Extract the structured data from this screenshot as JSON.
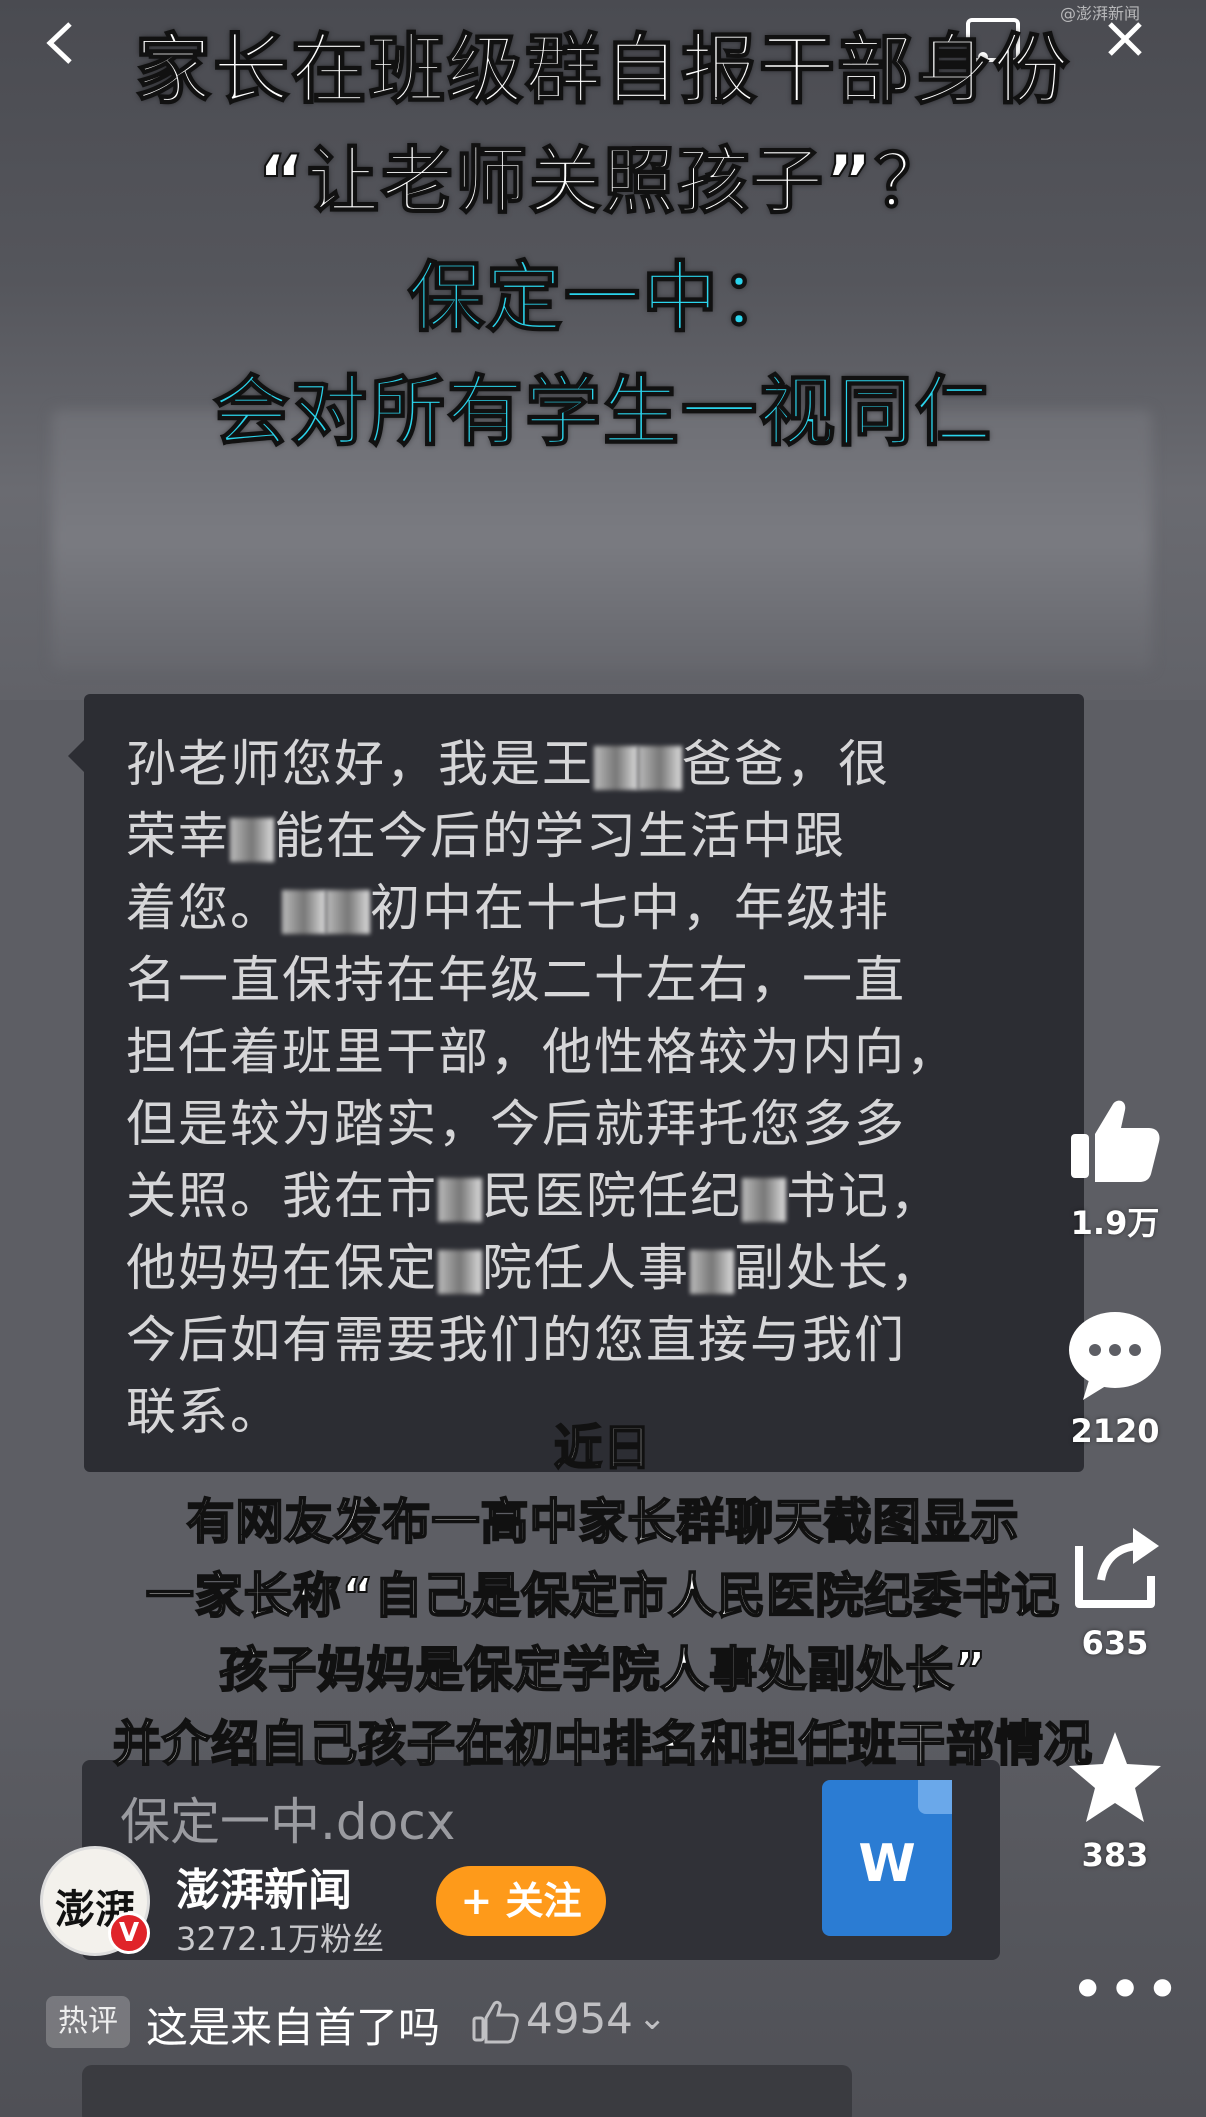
{
  "nav": {
    "back_icon": "chevron-left-icon",
    "cast_icon": "cast-icon",
    "close_icon": "close-icon",
    "watermark": "@澎湃新闻"
  },
  "headline": {
    "line1": "家长在班级群自报干部身份",
    "line2": "“让老师关照孩子”？",
    "line3": "保定一中：",
    "line4": "会对所有学生一视同仁",
    "accent_color": "#2ad4ec"
  },
  "chat": {
    "lines": [
      [
        "孙老师您好，我是王",
        "爸爸，很"
      ],
      [
        "荣幸",
        "能在今后的学习生活中跟"
      ],
      [
        "着您。",
        "初中在十七中，年级排"
      ],
      [
        "名一直保持在年级二十左右，一直"
      ],
      [
        "担任着班里干部，他性格较为内向，"
      ],
      [
        "但是较为踏实，今后就拜托您多多"
      ],
      [
        "关照。我在市",
        "民医院任纪",
        "书记，"
      ],
      [
        "他妈妈在保定",
        "院任人事",
        "副处长，"
      ],
      [
        "今后如有需要我们的您直接与我们"
      ],
      [
        "联系。"
      ]
    ]
  },
  "captions": [
    "近日",
    "有网友发布一高中家长群聊天截图显示",
    "一家长称“自己是保定市人民医院纪委书记",
    "孩子妈妈是保定学院人事处副处长”",
    "并介绍自己孩子在初中排名和担任班干部情况"
  ],
  "file": {
    "name": "保定一中.docx",
    "icon": "word-document-icon",
    "icon_letter": "W"
  },
  "actions": {
    "like": {
      "icon": "thumbs-up-icon",
      "count": "1.9万"
    },
    "comment": {
      "icon": "comment-bubble-icon",
      "count": "2120"
    },
    "share": {
      "icon": "share-icon",
      "count": "635"
    },
    "favorite": {
      "icon": "star-icon",
      "count": "383"
    }
  },
  "author": {
    "avatar_text": "澎湃",
    "verified_mark": "V",
    "name": "澎湃新闻",
    "followers": "3272.1万粉丝",
    "follow_label": "+ 关注"
  },
  "hot_comment": {
    "tag": "热评",
    "text": "这是来自首了吗",
    "like_count": "4954",
    "chevron": "⌄"
  },
  "more_label": "•••"
}
